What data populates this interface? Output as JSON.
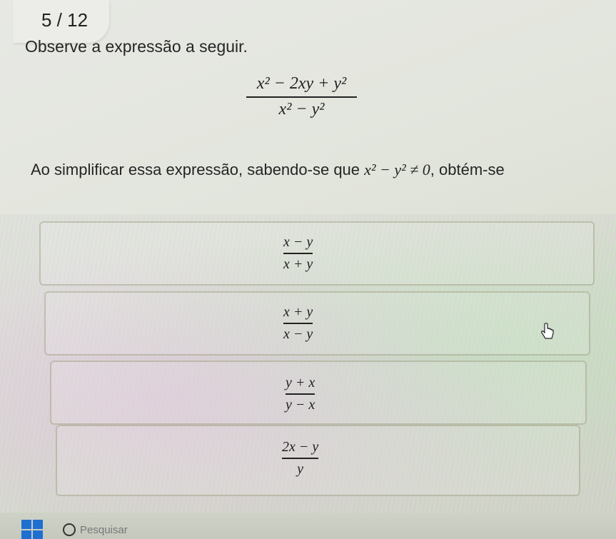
{
  "header": {
    "progress": "5 / 12",
    "prompt": "Observe a expressão a seguir."
  },
  "expression": {
    "numerator": "x² − 2xy + y²",
    "denominator": "x² − y²"
  },
  "question": {
    "before": "Ao simplificar essa expressão, sabendo-se que",
    "condition": "x² − y² ≠ 0",
    "after": ", obtém-se"
  },
  "options": [
    {
      "numerator": "x − y",
      "denominator": "x + y"
    },
    {
      "numerator": "x + y",
      "denominator": "x − y"
    },
    {
      "numerator": "y + x",
      "denominator": "y − x"
    },
    {
      "numerator": "2x − y",
      "denominator": "y"
    }
  ],
  "taskbar": {
    "search_text": "Pesquisar"
  },
  "colors": {
    "accent": "#1f6fd1"
  }
}
